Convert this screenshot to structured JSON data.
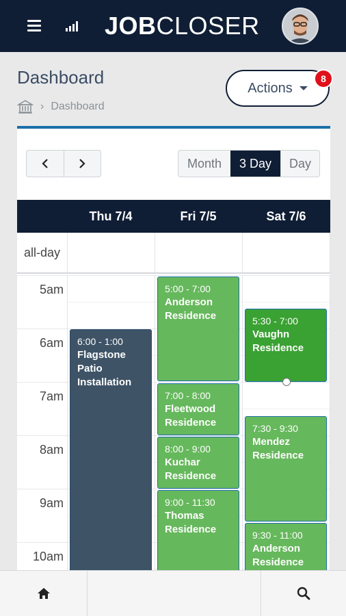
{
  "header": {
    "logo_bold": "JOB",
    "logo_light": "CLOSER",
    "menu_icon": "hamburger-icon",
    "stats_icon": "bar-chart-icon",
    "avatar_icon": "user-avatar"
  },
  "page": {
    "title": "Dashboard",
    "breadcrumb_home_icon": "home-building-icon",
    "breadcrumb_current": "Dashboard",
    "actions_label": "Actions",
    "actions_badge": "8"
  },
  "calendar": {
    "prev_label": "‹",
    "next_label": "›",
    "views": [
      "Month",
      "3 Day",
      "Day"
    ],
    "active_view": "3 Day",
    "days": [
      "Thu 7/4",
      "Fri 7/5",
      "Sat 7/6"
    ],
    "allday_label": "all-day",
    "time_labels": [
      "5am",
      "6am",
      "7am",
      "8am",
      "9am",
      "10am"
    ],
    "events": [
      {
        "time": "6:00 - 1:00",
        "title": "Flagstone Patio Installation",
        "day": "Thu 7/4"
      },
      {
        "time": "5:00 - 7:00",
        "title": "Anderson Residence",
        "day": "Fri 7/5"
      },
      {
        "time": "7:00 - 8:00",
        "title": "Fleetwood Residence",
        "day": "Fri 7/5"
      },
      {
        "time": "8:00 - 9:00",
        "title": "Kuchar Residence",
        "day": "Fri 7/5"
      },
      {
        "time": "9:00 - 11:30",
        "title": "Thomas Residence",
        "day": "Fri 7/5"
      },
      {
        "time": "5:30 - 7:00",
        "title": "Vaughn Residence",
        "day": "Sat 7/6"
      },
      {
        "time": "7:30 - 9:30",
        "title": "Mendez Residence",
        "day": "Sat 7/6"
      },
      {
        "time": "9:30 - 11:00",
        "title": "Anderson Residence",
        "day": "Sat 7/6"
      }
    ]
  },
  "bottom_nav": {
    "home_icon": "home-icon",
    "search_icon": "search-icon"
  },
  "colors": {
    "navy": "#0f1e35",
    "accent_blue": "#1b6fa8",
    "event_green": "#66b85c",
    "event_green_selected": "#3aa133",
    "event_dark": "#3e5366",
    "badge_red": "#e0101a"
  }
}
